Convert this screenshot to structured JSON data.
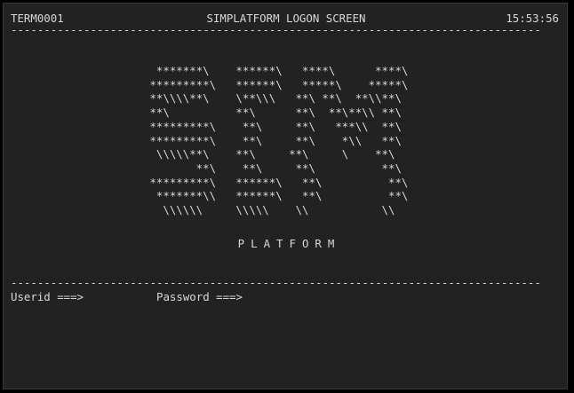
{
  "header": {
    "terminal_id": "TERM0001",
    "screen_title": "SIMPLATFORM LOGON SCREEN",
    "time": "15:53:56"
  },
  "separator": "--------------------------------------------------------------------------------",
  "logo_art": [
    "  *******\\    ******\\   ****\\      ****\\",
    " *********\\   ******\\   *****\\    *****\\",
    " **\\\\\\\\**\\    \\**\\\\\\   **\\ **\\  **\\\\**\\",
    " **\\          **\\      **\\  **\\**\\\\ **\\",
    " *********\\    **\\     **\\   ***\\\\  **\\",
    " *********\\    **\\     **\\    *\\\\   **\\",
    "  \\\\\\\\\\**\\    **\\     **\\     \\    **\\",
    "        **\\    **\\     **\\          **\\",
    " *********\\   ******\\   **\\          **\\",
    "  *******\\\\   ******\\   **\\          **\\",
    "   \\\\\\\\\\\\     \\\\\\\\\\    \\\\           \\\\"
  ],
  "subtitle": "PLATFORM",
  "login": {
    "userid_label": "Userid ===>",
    "userid_value": "",
    "password_label": "Password ===>",
    "password_value": ""
  },
  "colors": {
    "background": "#222222",
    "text": "#d8d8d8",
    "frame": "#000000"
  }
}
